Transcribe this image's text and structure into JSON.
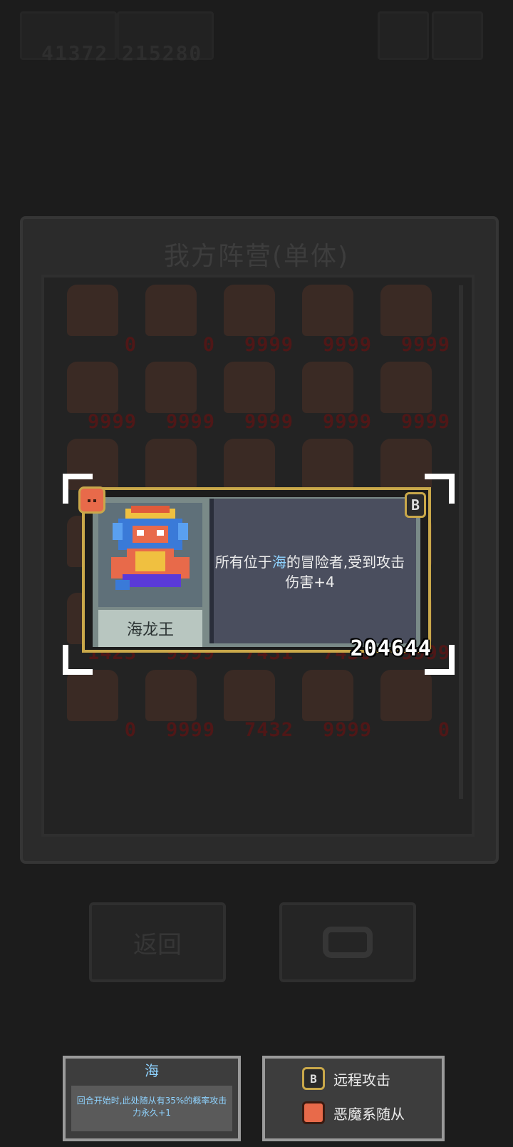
{
  "background": {
    "score": "41372 215280",
    "panel_title": "我方阵营(单体)",
    "back_label": "返回",
    "units": [
      "0",
      "0",
      "9999",
      "9999",
      "9999",
      "9999",
      "9999",
      "9999",
      "9999",
      "9999",
      "",
      "",
      "",
      "9999",
      "",
      "",
      "",
      "",
      "",
      "",
      "1423",
      "9999",
      "7431",
      "7430",
      "9999",
      "0",
      "9999",
      "7432",
      "9999",
      "0"
    ]
  },
  "card": {
    "name": "海龙王",
    "description_prefix": "所有位于",
    "description_highlight": "海",
    "description_suffix": "的冒险者,受到攻击伤害+4",
    "power": "204644",
    "ranged_glyph": "B"
  },
  "info": {
    "terrain_title": "海",
    "terrain_text": "回合开始时,此处随从有35%的概率攻击力永久+1",
    "legend": [
      {
        "icon": "ranged-attack-icon",
        "label": "远程攻击"
      },
      {
        "icon": "demon-icon",
        "label": "恶魔系随从"
      }
    ]
  },
  "colors": {
    "gold_border": "#c9a84a",
    "highlight_blue": "#8fd3ff",
    "demon_orange": "#e86a4a"
  }
}
